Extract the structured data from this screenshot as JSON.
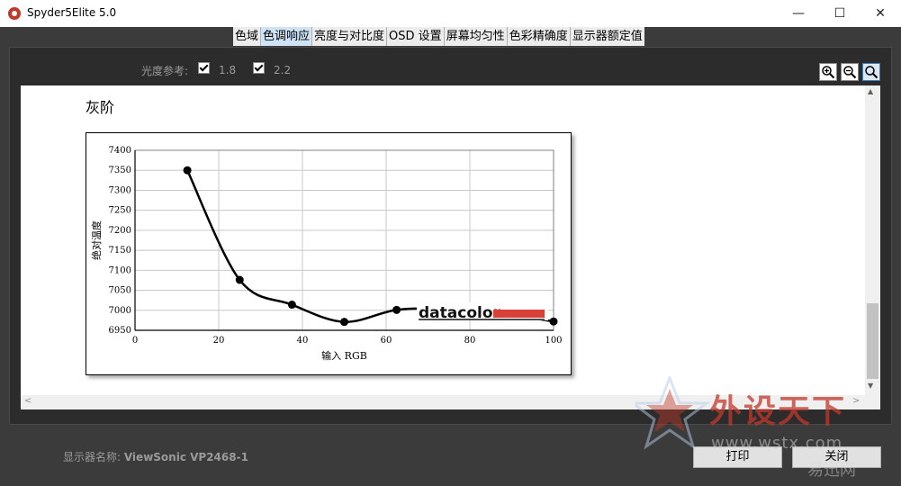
{
  "window": {
    "title": "Spyder5Elite 5.0",
    "minimize": "—",
    "maximize": "☐",
    "close": "✕"
  },
  "tabs": [
    {
      "label": "色域",
      "active": false
    },
    {
      "label": "色调响应",
      "active": true
    },
    {
      "label": "亮度与对比度",
      "active": false
    },
    {
      "label": "OSD 设置",
      "active": false
    },
    {
      "label": "屏幕均匀性",
      "active": false
    },
    {
      "label": "色彩精确度",
      "active": false
    },
    {
      "label": "显示器额定值",
      "active": false
    }
  ],
  "toolbar": {
    "luminance_ref_label": "光度参考:",
    "option1": {
      "label": "1.8",
      "checked": true
    },
    "option2": {
      "label": "2.2",
      "checked": true
    },
    "zoom_in": "zoom-in-icon",
    "zoom_out": "zoom-out-icon",
    "zoom_fit": "zoom-icon"
  },
  "report": {
    "section_title": "灰阶"
  },
  "chart_data": {
    "type": "line",
    "xlabel": "输入 RGB",
    "ylabel": "绝对温度",
    "xlim": [
      0,
      100
    ],
    "ylim": [
      6950,
      7400
    ],
    "x_ticks": [
      "0",
      "20",
      "40",
      "60",
      "80",
      "100"
    ],
    "y_ticks": [
      "6950",
      "7000",
      "7050",
      "7100",
      "7150",
      "7200",
      "7250",
      "7300",
      "7350",
      "7400"
    ],
    "grid": true,
    "series": [
      {
        "x": [
          12.5,
          25,
          37.5,
          50,
          62.5,
          75,
          87.5,
          100
        ],
        "y": [
          7350,
          7076,
          7014,
          6971,
          7001,
          7003,
          6992,
          6972
        ]
      }
    ],
    "logo": "datacolor",
    "accent_color": "#d9403a"
  },
  "footer": {
    "display_name_label": "显示器名称: ",
    "display_name_value": "ViewSonic VP2468-1",
    "print_button": "打印",
    "close_button": "关闭"
  },
  "watermark": {
    "line1": "外设天下",
    "line2": "www.wstx.com",
    "line3": "易迅网"
  }
}
